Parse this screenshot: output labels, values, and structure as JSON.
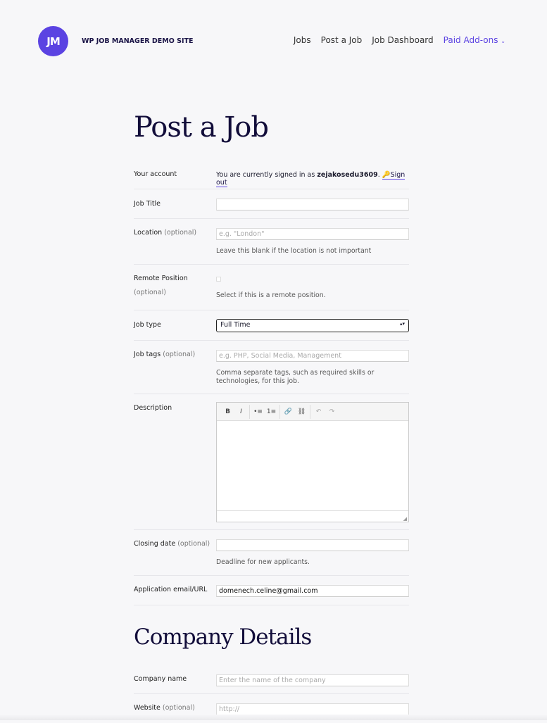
{
  "header": {
    "logo": "JM",
    "site_title": "WP JOB MANAGER DEMO SITE",
    "nav": [
      "Jobs",
      "Post a Job",
      "Job Dashboard",
      "Paid Add-ons"
    ],
    "accent": "#5b43e2"
  },
  "page_title": "Post a Job",
  "account": {
    "label": "Your account",
    "text": "You are currently signed in as ",
    "user": "zejakosedu3609",
    "sign_out": "Sign out"
  },
  "fields": {
    "job_title": {
      "label": "Job Title",
      "value": ""
    },
    "location": {
      "label": "Location",
      "optional": "(optional)",
      "placeholder": "e.g. \"London\"",
      "hint": "Leave this blank if the location is not important"
    },
    "remote": {
      "label": "Remote Position",
      "optional": "(optional)",
      "hint": "Select if this is a remote position.",
      "checked": false
    },
    "job_type": {
      "label": "Job type",
      "value": "Full Time"
    },
    "job_tags": {
      "label": "Job tags",
      "optional": "(optional)",
      "placeholder": "e.g. PHP, Social Media, Management",
      "hint": "Comma separate tags, such as required skills or technologies, for this job."
    },
    "description": {
      "label": "Description",
      "toolbar": [
        "B",
        "I",
        "•≡",
        "1≡",
        "🔗",
        "⛓",
        "↶",
        "↷"
      ]
    },
    "closing_date": {
      "label": "Closing date",
      "optional": "(optional)",
      "hint": "Deadline for new applicants."
    },
    "application": {
      "label": "Application email/URL",
      "value": "domenech.celine@gmail.com"
    }
  },
  "company": {
    "title": "Company Details",
    "name": {
      "label": "Company name",
      "placeholder": "Enter the name of the company"
    },
    "website": {
      "label": "Website",
      "optional": "(optional)",
      "placeholder": "http://"
    }
  }
}
